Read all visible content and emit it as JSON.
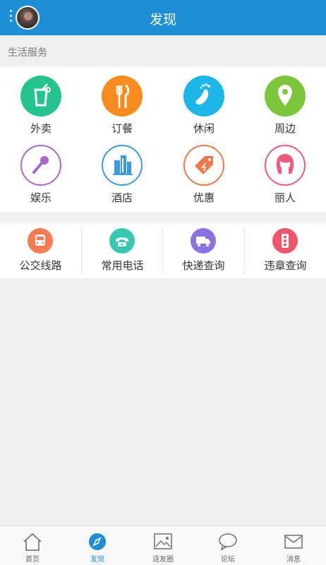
{
  "header": {
    "title": "发现",
    "menu_icon": "more-vert-icon",
    "avatar": "user-avatar"
  },
  "section": {
    "label": "生活服务"
  },
  "services": [
    {
      "label": "外卖",
      "icon": "drink-icon",
      "color": "#25c48f"
    },
    {
      "label": "订餐",
      "icon": "fork-knife-icon",
      "color": "#f98a1c"
    },
    {
      "label": "休闲",
      "icon": "footprint-icon",
      "color": "#1db6e8"
    },
    {
      "label": "周边",
      "icon": "location-pin-icon",
      "color": "#7cc63b"
    },
    {
      "label": "娱乐",
      "icon": "microphone-icon",
      "color": "#a766cd"
    },
    {
      "label": "酒店",
      "icon": "building-icon",
      "color": "#3a9bdc"
    },
    {
      "label": "优惠",
      "icon": "discount-tag-icon",
      "color": "#ee7a4b"
    },
    {
      "label": "丽人",
      "icon": "woman-icon",
      "color": "#ee5a7c"
    }
  ],
  "tools": [
    {
      "label": "公交线路",
      "icon": "bus-icon",
      "color": "#f47b52"
    },
    {
      "label": "常用电话",
      "icon": "phone-icon",
      "color": "#38c8b2"
    },
    {
      "label": "快递查询",
      "icon": "delivery-truck-icon",
      "color": "#8c72e0"
    },
    {
      "label": "违章查询",
      "icon": "traffic-light-icon",
      "color": "#f0556a"
    }
  ],
  "tabs": [
    {
      "label": "首页",
      "icon": "home-icon",
      "active": false
    },
    {
      "label": "发现",
      "icon": "compass-icon",
      "active": true
    },
    {
      "label": "涟友圈",
      "icon": "image-icon",
      "active": false
    },
    {
      "label": "论坛",
      "icon": "chat-bubble-icon",
      "active": false
    },
    {
      "label": "消息",
      "icon": "mail-icon",
      "active": false
    }
  ],
  "colors": {
    "primary": "#1e8fd6",
    "background": "#efefef"
  }
}
